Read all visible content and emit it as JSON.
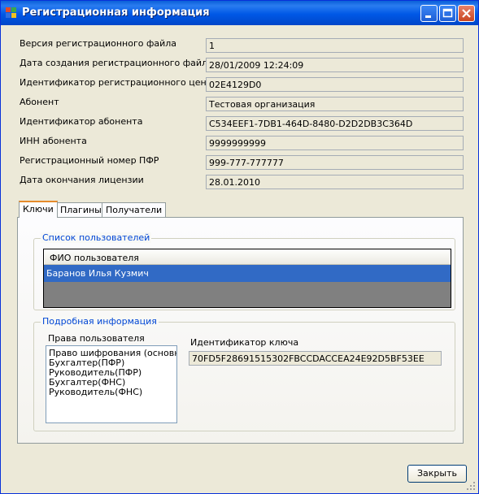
{
  "window": {
    "title": "Регистрационная информация"
  },
  "fields": [
    {
      "label": "Версия регистрационного файла",
      "value": "1"
    },
    {
      "label": "Дата создания регистрационного файла",
      "value": "28/01/2009 12:24:09"
    },
    {
      "label": "Идентификатор регистрационного центра",
      "value": "02E4129D0"
    },
    {
      "label": "Абонент",
      "value": "Тестовая организация"
    },
    {
      "label": "Идентификатор абонента",
      "value": "C534EEF1-7DB1-464D-8480-D2D2DB3C364D"
    },
    {
      "label": "ИНН абонента",
      "value": "9999999999"
    },
    {
      "label": "Регистрационный номер ПФР",
      "value": "999-777-777777"
    },
    {
      "label": "Дата окончания лицензии",
      "value": "28.01.2010"
    }
  ],
  "tabs": [
    {
      "label": "Ключи"
    },
    {
      "label": "Плагины"
    },
    {
      "label": "Получатели"
    }
  ],
  "users_group": {
    "title": "Список пользователей",
    "column_header": "ФИО пользователя",
    "rows": [
      "Баранов Илья Кузмич"
    ]
  },
  "details_group": {
    "title": "Подробная информация",
    "rights_label": "Права пользователя",
    "rights": [
      "Право шифрования (основной",
      "Бухгалтер(ПФР)",
      "Руководитель(ПФР)",
      "Бухгалтер(ФНС)",
      "Руководитель(ФНС)"
    ],
    "key_id_label": "Идентификатор ключа",
    "key_id_value": "70FD5F28691515302FBCCDACCEA24E92D5BF53EE"
  },
  "buttons": {
    "close": "Закрыть"
  },
  "colors": {
    "titlebar": "#0058e6",
    "selection": "#316ac5",
    "group_title": "#0046d5",
    "window_bg": "#ece9d8"
  }
}
